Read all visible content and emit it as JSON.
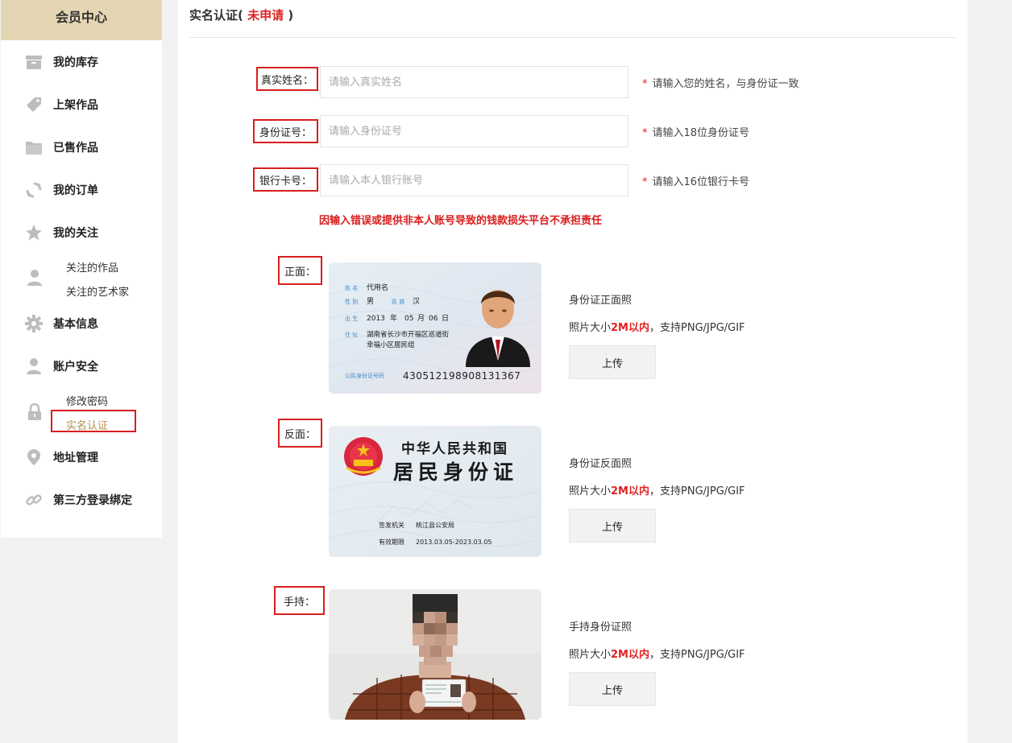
{
  "sidebar": {
    "title": "会员中心",
    "items": [
      {
        "label": "我的库存",
        "icon": "inventory-box-icon"
      },
      {
        "label": "上架作品",
        "icon": "tag-icon"
      },
      {
        "label": "已售作品",
        "icon": "folder-icon"
      },
      {
        "label": "我的订单",
        "icon": "refresh-cycle-icon"
      },
      {
        "label": "我的关注",
        "icon": "star-icon"
      },
      {
        "label": "基本信息",
        "icon": "gear-icon"
      },
      {
        "label": "账户安全",
        "icon": "user-icon"
      },
      {
        "label": "地址管理",
        "icon": "location-pin-icon"
      },
      {
        "label": "第三方登录绑定",
        "icon": "link-icon"
      }
    ],
    "follow_sub": [
      "关注的作品",
      "关注的艺术家"
    ],
    "security_sub": [
      "修改密码",
      "实名认证"
    ]
  },
  "page": {
    "title_prefix": "实名认证(",
    "status": "未申请",
    "title_suffix": ")"
  },
  "form": {
    "name": {
      "label": "真实姓名：",
      "placeholder": "请输入真实姓名",
      "hint": "请输入您的姓名，与身份证一致"
    },
    "id": {
      "label": "身份证号：",
      "placeholder": "请输入身份证号",
      "hint": "请输入18位身份证号"
    },
    "bank": {
      "label": "银行卡号：",
      "placeholder": "请输入本人银行账号",
      "hint": "请输入16位银行卡号"
    },
    "star": "*",
    "warning": "因输入错误或提供非本人账号导致的钱款损失平台不承担责任"
  },
  "photos": {
    "size_prefix": "照片大小",
    "size_value": "2M以内",
    "size_suffix": "，支持PNG/JPG/GIF",
    "upload_label": "上传",
    "front": {
      "label": "正面：",
      "title": "身份证正面照",
      "card": {
        "name_k": "姓 名",
        "name_v": "代用名",
        "sex_k": "性 别",
        "sex_v": "男",
        "eth_k": "民 族",
        "eth_v": "汉",
        "birth_k": "出 生",
        "birth_y": "2013",
        "birth_m": "05",
        "birth_d": "06",
        "y": "年",
        "m": "月",
        "d": "日",
        "addr_k": "住 址",
        "addr_1": "湖南省长沙市开福区巡道街",
        "addr_2": "幸福小区居民组",
        "num_k": "公民身份证号码",
        "num_v": "430512198908131367"
      }
    },
    "back": {
      "label": "反面：",
      "title": "身份证反面照",
      "card": {
        "country": "中华人民共和国",
        "doc": "居民身份证",
        "issuer_k": "签发机关",
        "issuer_v": "桃江县公安局",
        "valid_k": "有效期限",
        "valid_v": "2013.03.05-2023.03.05"
      }
    },
    "hold": {
      "label": "手持：",
      "title": "手持身份证照"
    }
  }
}
